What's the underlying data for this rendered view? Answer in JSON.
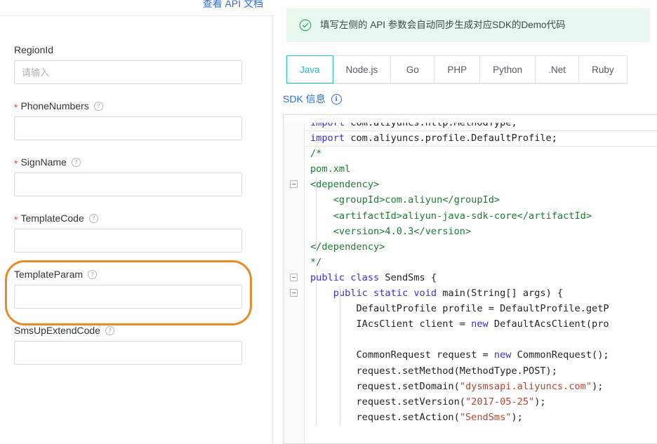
{
  "left_panel": {
    "doc_link": "查看 API 文档",
    "fields": [
      {
        "label": "RegionId",
        "required": false,
        "help": false,
        "placeholder": "请输入",
        "value": ""
      },
      {
        "label": "PhoneNumbers",
        "required": true,
        "help": true,
        "placeholder": "",
        "value": ""
      },
      {
        "label": "SignName",
        "required": true,
        "help": true,
        "placeholder": "",
        "value": ""
      },
      {
        "label": "TemplateCode",
        "required": true,
        "help": true,
        "placeholder": "",
        "value": ""
      },
      {
        "label": "TemplateParam",
        "required": false,
        "help": true,
        "placeholder": "",
        "value": ""
      },
      {
        "label": "SmsUpExtendCode",
        "required": false,
        "help": true,
        "placeholder": "",
        "value": ""
      }
    ],
    "highlight": {
      "field": "TemplateParam",
      "color": "#e98a28"
    }
  },
  "right_panel": {
    "alert": {
      "icon": "check-circle-icon",
      "text": "填写左侧的 API 参数会自动同步生成对应SDK的Demo代码",
      "background": "#e8f8ee",
      "icon_color": "#36a96a"
    },
    "tabs": [
      {
        "label": "Java",
        "active": true
      },
      {
        "label": "Node.js",
        "active": false
      },
      {
        "label": "Go",
        "active": false
      },
      {
        "label": "PHP",
        "active": false
      },
      {
        "label": "Python",
        "active": false
      },
      {
        "label": ".Net",
        "active": false
      },
      {
        "label": "Ruby",
        "active": false
      }
    ],
    "active_tab_color": "#1fc0c8",
    "sdk_info": {
      "label": "SDK 信息",
      "icon": "info-circle-icon",
      "color": "#2f6fdd"
    },
    "code": {
      "language": "Java",
      "lines": [
        {
          "indent": 0,
          "fold": false,
          "tokens": [
            {
              "t": "import ",
              "c": "kw"
            },
            {
              "t": "com.aliyuncs.http.MethodType;",
              "c": "plain"
            }
          ],
          "clipped_top": true
        },
        {
          "indent": 0,
          "fold": false,
          "tokens": [
            {
              "t": "import ",
              "c": "kw"
            },
            {
              "t": "com.aliyuncs.profile.DefaultProfile;",
              "c": "plain"
            }
          ]
        },
        {
          "indent": 0,
          "fold": false,
          "tokens": [
            {
              "t": "/*",
              "c": "cmt"
            }
          ]
        },
        {
          "indent": 0,
          "fold": false,
          "tokens": [
            {
              "t": "pom.xml",
              "c": "cmt"
            }
          ]
        },
        {
          "indent": 0,
          "fold": true,
          "tokens": [
            {
              "t": "<dependency>",
              "c": "cmt"
            }
          ]
        },
        {
          "indent": 1,
          "fold": false,
          "tokens": [
            {
              "t": "<groupId>com.aliyun</groupId>",
              "c": "cmt"
            }
          ]
        },
        {
          "indent": 1,
          "fold": false,
          "tokens": [
            {
              "t": "<artifactId>aliyun-java-sdk-core</artifactId>",
              "c": "cmt"
            }
          ]
        },
        {
          "indent": 1,
          "fold": false,
          "tokens": [
            {
              "t": "<version>4.0.3</version>",
              "c": "cmt"
            }
          ]
        },
        {
          "indent": 0,
          "fold": false,
          "tokens": [
            {
              "t": "</dependency>",
              "c": "cmt"
            }
          ]
        },
        {
          "indent": 0,
          "fold": false,
          "tokens": [
            {
              "t": "*/",
              "c": "cmt"
            }
          ]
        },
        {
          "indent": 0,
          "fold": true,
          "tokens": [
            {
              "t": "public class ",
              "c": "kw"
            },
            {
              "t": "SendSms {",
              "c": "plain"
            }
          ]
        },
        {
          "indent": 1,
          "fold": true,
          "tokens": [
            {
              "t": "public static void ",
              "c": "kw"
            },
            {
              "t": "main(String[] args) {",
              "c": "plain"
            }
          ]
        },
        {
          "indent": 2,
          "fold": false,
          "tokens": [
            {
              "t": "DefaultProfile profile = DefaultProfile.getP",
              "c": "plain"
            }
          ]
        },
        {
          "indent": 2,
          "fold": false,
          "tokens": [
            {
              "t": "IAcsClient client = ",
              "c": "plain"
            },
            {
              "t": "new ",
              "c": "kw"
            },
            {
              "t": "DefaultAcsClient(pro",
              "c": "plain"
            }
          ]
        },
        {
          "indent": 2,
          "fold": false,
          "tokens": [
            {
              "t": "",
              "c": "plain"
            }
          ]
        },
        {
          "indent": 2,
          "fold": false,
          "tokens": [
            {
              "t": "CommonRequest request = ",
              "c": "plain"
            },
            {
              "t": "new ",
              "c": "kw"
            },
            {
              "t": "CommonRequest();",
              "c": "plain"
            }
          ]
        },
        {
          "indent": 2,
          "fold": false,
          "tokens": [
            {
              "t": "request.setMethod(MethodType.POST);",
              "c": "plain"
            }
          ]
        },
        {
          "indent": 2,
          "fold": false,
          "tokens": [
            {
              "t": "request.setDomain(",
              "c": "plain"
            },
            {
              "t": "\"dysmsapi.aliyuncs.com\"",
              "c": "str"
            },
            {
              "t": ");",
              "c": "plain"
            }
          ]
        },
        {
          "indent": 2,
          "fold": false,
          "tokens": [
            {
              "t": "request.setVersion(",
              "c": "plain"
            },
            {
              "t": "\"2017-05-25\"",
              "c": "str"
            },
            {
              "t": ");",
              "c": "plain"
            }
          ]
        },
        {
          "indent": 2,
          "fold": false,
          "tokens": [
            {
              "t": "request.setAction(",
              "c": "plain"
            },
            {
              "t": "\"SendSms\"",
              "c": "str"
            },
            {
              "t": ");",
              "c": "plain"
            }
          ]
        }
      ]
    }
  }
}
